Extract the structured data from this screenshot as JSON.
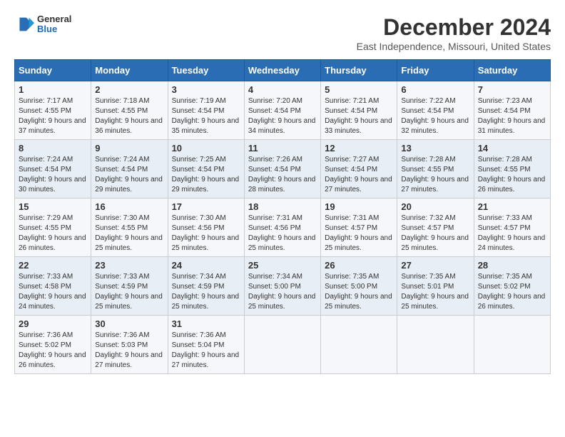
{
  "header": {
    "logo_line1": "General",
    "logo_line2": "Blue",
    "title": "December 2024",
    "subtitle": "East Independence, Missouri, United States"
  },
  "days_of_week": [
    "Sunday",
    "Monday",
    "Tuesday",
    "Wednesday",
    "Thursday",
    "Friday",
    "Saturday"
  ],
  "weeks": [
    [
      {
        "day": "1",
        "sunrise": "Sunrise: 7:17 AM",
        "sunset": "Sunset: 4:55 PM",
        "daylight": "Daylight: 9 hours and 37 minutes."
      },
      {
        "day": "2",
        "sunrise": "Sunrise: 7:18 AM",
        "sunset": "Sunset: 4:55 PM",
        "daylight": "Daylight: 9 hours and 36 minutes."
      },
      {
        "day": "3",
        "sunrise": "Sunrise: 7:19 AM",
        "sunset": "Sunset: 4:54 PM",
        "daylight": "Daylight: 9 hours and 35 minutes."
      },
      {
        "day": "4",
        "sunrise": "Sunrise: 7:20 AM",
        "sunset": "Sunset: 4:54 PM",
        "daylight": "Daylight: 9 hours and 34 minutes."
      },
      {
        "day": "5",
        "sunrise": "Sunrise: 7:21 AM",
        "sunset": "Sunset: 4:54 PM",
        "daylight": "Daylight: 9 hours and 33 minutes."
      },
      {
        "day": "6",
        "sunrise": "Sunrise: 7:22 AM",
        "sunset": "Sunset: 4:54 PM",
        "daylight": "Daylight: 9 hours and 32 minutes."
      },
      {
        "day": "7",
        "sunrise": "Sunrise: 7:23 AM",
        "sunset": "Sunset: 4:54 PM",
        "daylight": "Daylight: 9 hours and 31 minutes."
      }
    ],
    [
      {
        "day": "8",
        "sunrise": "Sunrise: 7:24 AM",
        "sunset": "Sunset: 4:54 PM",
        "daylight": "Daylight: 9 hours and 30 minutes."
      },
      {
        "day": "9",
        "sunrise": "Sunrise: 7:24 AM",
        "sunset": "Sunset: 4:54 PM",
        "daylight": "Daylight: 9 hours and 29 minutes."
      },
      {
        "day": "10",
        "sunrise": "Sunrise: 7:25 AM",
        "sunset": "Sunset: 4:54 PM",
        "daylight": "Daylight: 9 hours and 29 minutes."
      },
      {
        "day": "11",
        "sunrise": "Sunrise: 7:26 AM",
        "sunset": "Sunset: 4:54 PM",
        "daylight": "Daylight: 9 hours and 28 minutes."
      },
      {
        "day": "12",
        "sunrise": "Sunrise: 7:27 AM",
        "sunset": "Sunset: 4:54 PM",
        "daylight": "Daylight: 9 hours and 27 minutes."
      },
      {
        "day": "13",
        "sunrise": "Sunrise: 7:28 AM",
        "sunset": "Sunset: 4:55 PM",
        "daylight": "Daylight: 9 hours and 27 minutes."
      },
      {
        "day": "14",
        "sunrise": "Sunrise: 7:28 AM",
        "sunset": "Sunset: 4:55 PM",
        "daylight": "Daylight: 9 hours and 26 minutes."
      }
    ],
    [
      {
        "day": "15",
        "sunrise": "Sunrise: 7:29 AM",
        "sunset": "Sunset: 4:55 PM",
        "daylight": "Daylight: 9 hours and 26 minutes."
      },
      {
        "day": "16",
        "sunrise": "Sunrise: 7:30 AM",
        "sunset": "Sunset: 4:55 PM",
        "daylight": "Daylight: 9 hours and 25 minutes."
      },
      {
        "day": "17",
        "sunrise": "Sunrise: 7:30 AM",
        "sunset": "Sunset: 4:56 PM",
        "daylight": "Daylight: 9 hours and 25 minutes."
      },
      {
        "day": "18",
        "sunrise": "Sunrise: 7:31 AM",
        "sunset": "Sunset: 4:56 PM",
        "daylight": "Daylight: 9 hours and 25 minutes."
      },
      {
        "day": "19",
        "sunrise": "Sunrise: 7:31 AM",
        "sunset": "Sunset: 4:57 PM",
        "daylight": "Daylight: 9 hours and 25 minutes."
      },
      {
        "day": "20",
        "sunrise": "Sunrise: 7:32 AM",
        "sunset": "Sunset: 4:57 PM",
        "daylight": "Daylight: 9 hours and 25 minutes."
      },
      {
        "day": "21",
        "sunrise": "Sunrise: 7:33 AM",
        "sunset": "Sunset: 4:57 PM",
        "daylight": "Daylight: 9 hours and 24 minutes."
      }
    ],
    [
      {
        "day": "22",
        "sunrise": "Sunrise: 7:33 AM",
        "sunset": "Sunset: 4:58 PM",
        "daylight": "Daylight: 9 hours and 24 minutes."
      },
      {
        "day": "23",
        "sunrise": "Sunrise: 7:33 AM",
        "sunset": "Sunset: 4:59 PM",
        "daylight": "Daylight: 9 hours and 25 minutes."
      },
      {
        "day": "24",
        "sunrise": "Sunrise: 7:34 AM",
        "sunset": "Sunset: 4:59 PM",
        "daylight": "Daylight: 9 hours and 25 minutes."
      },
      {
        "day": "25",
        "sunrise": "Sunrise: 7:34 AM",
        "sunset": "Sunset: 5:00 PM",
        "daylight": "Daylight: 9 hours and 25 minutes."
      },
      {
        "day": "26",
        "sunrise": "Sunrise: 7:35 AM",
        "sunset": "Sunset: 5:00 PM",
        "daylight": "Daylight: 9 hours and 25 minutes."
      },
      {
        "day": "27",
        "sunrise": "Sunrise: 7:35 AM",
        "sunset": "Sunset: 5:01 PM",
        "daylight": "Daylight: 9 hours and 25 minutes."
      },
      {
        "day": "28",
        "sunrise": "Sunrise: 7:35 AM",
        "sunset": "Sunset: 5:02 PM",
        "daylight": "Daylight: 9 hours and 26 minutes."
      }
    ],
    [
      {
        "day": "29",
        "sunrise": "Sunrise: 7:36 AM",
        "sunset": "Sunset: 5:02 PM",
        "daylight": "Daylight: 9 hours and 26 minutes."
      },
      {
        "day": "30",
        "sunrise": "Sunrise: 7:36 AM",
        "sunset": "Sunset: 5:03 PM",
        "daylight": "Daylight: 9 hours and 27 minutes."
      },
      {
        "day": "31",
        "sunrise": "Sunrise: 7:36 AM",
        "sunset": "Sunset: 5:04 PM",
        "daylight": "Daylight: 9 hours and 27 minutes."
      },
      null,
      null,
      null,
      null
    ]
  ]
}
